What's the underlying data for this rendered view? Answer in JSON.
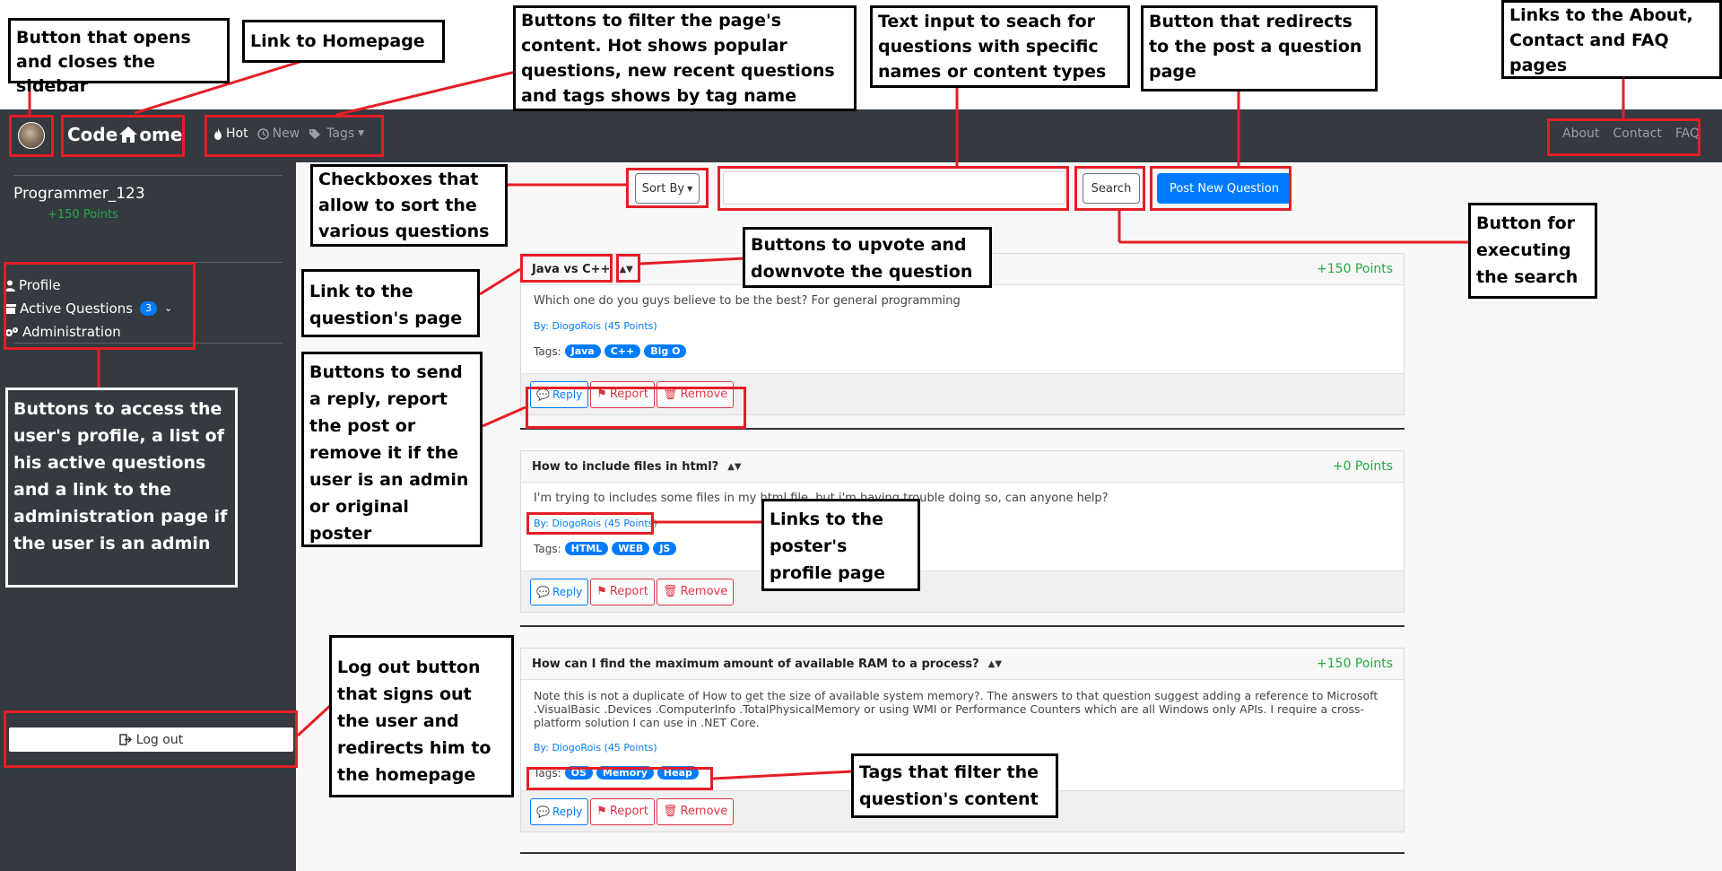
{
  "navbar": {
    "brand_left": "Code",
    "brand_right": "ome",
    "links": [
      {
        "label": "Hot",
        "icon": "fire-icon"
      },
      {
        "label": "New",
        "icon": "clock-icon"
      },
      {
        "label": "Tags",
        "icon": "tags-icon"
      }
    ],
    "right_links": [
      "About",
      "Contact",
      "FAQ"
    ]
  },
  "sidebar": {
    "username": "Programmer_123",
    "points": "+150 Points",
    "items": [
      {
        "label": "Profile",
        "icon": "user-icon"
      },
      {
        "label": "Active Questions",
        "icon": "archive-icon",
        "badge": "3"
      },
      {
        "label": "Administration",
        "icon": "cogs-icon"
      }
    ],
    "logout": "Log out"
  },
  "toolbar": {
    "sort_label": "Sort By",
    "search_placeholder": "",
    "search_label": "Search",
    "post_label": "Post New Question"
  },
  "questions": [
    {
      "title": "Java vs C++",
      "points": "+150 Points",
      "body": "Which one do you guys believe to be the best? For general programming",
      "by": "By: DiogoRois (45 Points)",
      "tags_label": "Tags:",
      "tags": [
        "Java",
        "C++",
        "Big O"
      ]
    },
    {
      "title": "How to include files in html?",
      "points": "+0 Points",
      "body": "I'm trying to includes some files in my html file, but i'm having trouble doing so, can anyone help?",
      "by": "By: DiogoRois (45 Points)",
      "tags_label": "Tags:",
      "tags": [
        "HTML",
        "WEB",
        "JS"
      ]
    },
    {
      "title": "How can I find the maximum amount of available RAM to a process?",
      "points": "+150 Points",
      "body": "Note this is not a duplicate of How to get the size of available system memory?. The answers to that question suggest adding a reference to Microsoft .VisualBasic .Devices .ComputerInfo .TotalPhysicalMemory or using WMI or Performance Counters which are all Windows only APIs. I require a cross-platform solution I can use in .NET Core.",
      "by": "By: DiogoRois (45 Points)",
      "tags_label": "Tags:",
      "tags": [
        "OS",
        "Memory",
        "Heap"
      ]
    }
  ],
  "actions": {
    "reply": "Reply",
    "report": "Report",
    "remove": "Remove"
  },
  "annotations": {
    "sidebar_toggle": "Button that opens and closes the sidebar",
    "home_link": "Link to Homepage",
    "filters": "Buttons to filter the page's content. Hot shows popular questions, new recent questions and tags shows by tag name",
    "search_text": "Text input to seach for questions with specific names or content types",
    "post_question": "Button that redirects to the post a question page",
    "about_links": "Links to the About, Contact and FAQ pages",
    "sort_checkboxes": "Checkboxes that allow to sort the various questions",
    "vote": "Buttons to upvote and downvote the question",
    "search_exec": "Button for executing the search",
    "question_link": "Link to the question's page",
    "reply_report": "Buttons to send a reply, report the post or remove it if the user is an admin or original poster",
    "sidebar_list": "Buttons to access the user's profile, a list of his active questions and a link to the administration page if the user is an admin",
    "poster_link": "Links to the poster's profile page",
    "logout": "Log out button that signs out the user and redirects him to the homepage",
    "tags_filter": "Tags that filter the question's content"
  },
  "colors": {
    "navbar": "#343a40",
    "primary": "#007bff",
    "danger": "#dc3545",
    "success": "#28a745",
    "annotation_red": "#e41e26"
  }
}
